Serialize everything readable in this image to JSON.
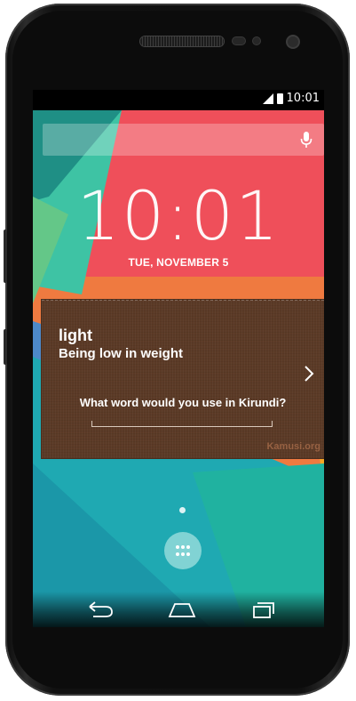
{
  "status_bar": {
    "time": "10:01",
    "signal_icon": "signal-icon",
    "battery_icon": "battery-icon"
  },
  "search": {
    "placeholder": "",
    "mic_icon": "mic-icon"
  },
  "lockscreen": {
    "time": "10:01",
    "date": "TUE, NOVEMBER 5"
  },
  "widget": {
    "word": "light",
    "definition": "Being low in weight",
    "question": "What word would you use in Kirundi?",
    "answer_value": "",
    "watermark": "Kamusi.org",
    "next_icon": "chevron-right-icon"
  },
  "home": {
    "app_drawer_icon": "app-drawer-icon"
  },
  "navbar": {
    "back_icon": "back-icon",
    "home_icon": "home-icon",
    "recents_icon": "recents-icon"
  },
  "colors": {
    "wallpaper_red": "#ef4f5a",
    "wallpaper_orange": "#ef7a40",
    "wallpaper_teal": "#1fa9b2",
    "card_brown": "#5b3a26"
  }
}
